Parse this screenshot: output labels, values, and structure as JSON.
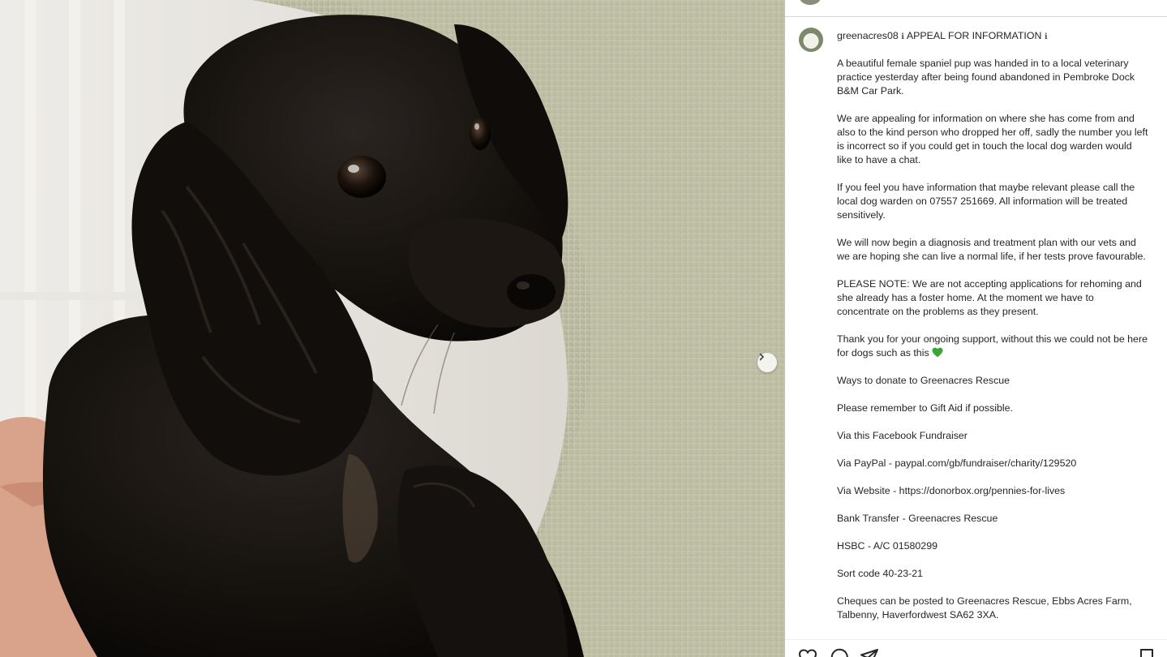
{
  "post": {
    "username": "greenacres08",
    "info_icon": "info-icon",
    "headline": "APPEAL FOR INFORMATION",
    "paragraphs": [
      "A beautiful female spaniel pup was handed in to a local veterinary practice yesterday after being found abandoned in Pembroke Dock B&M Car Park.",
      "We are appealing for information on where she has come from and also to the kind person who dropped her off, sadly the number you left is incorrect so if you could get in touch the local dog warden would like to have a chat.",
      "If you feel you have information that maybe relevant please call the local dog warden on 07557 251669. All information will be treated sensitively.",
      "We will now begin a diagnosis and treatment plan with our vets and we are hoping she can live a normal life, if her tests prove favourable.",
      "PLEASE NOTE: We are not accepting applications for rehoming and she already has a foster home. At the moment we have to concentrate on the problems as they present.",
      "Thank you for your ongoing support, without this we could not be here for dogs such as this",
      "Ways to donate to Greenacres Rescue",
      "Please remember to Gift Aid if possible.",
      "Via this Facebook Fundraiser",
      "Via PayPal - paypal.com/gb/fundraiser/charity/129520",
      "Via Website - https://donorbox.org/pennies-for-lives",
      "Bank Transfer - Greenacres Rescue",
      "HSBC - A/C 01580299",
      "Sort code 40-23-21",
      "Cheques can be posted to Greenacres Rescue, Ebbs Acres Farm, Talbenny, Haverfordwest SA62 3XA."
    ],
    "emoji": "green-heart-icon",
    "colors": {
      "heart": "#3aa635",
      "text": "#262626",
      "divider": "#dbdbdb"
    }
  },
  "photo": {
    "description_icon": "spaniel-puppy-photo",
    "next_icon": "chevron-right-icon"
  },
  "actions": [
    "heart-icon",
    "comment-icon",
    "share-icon",
    "bookmark-icon"
  ]
}
